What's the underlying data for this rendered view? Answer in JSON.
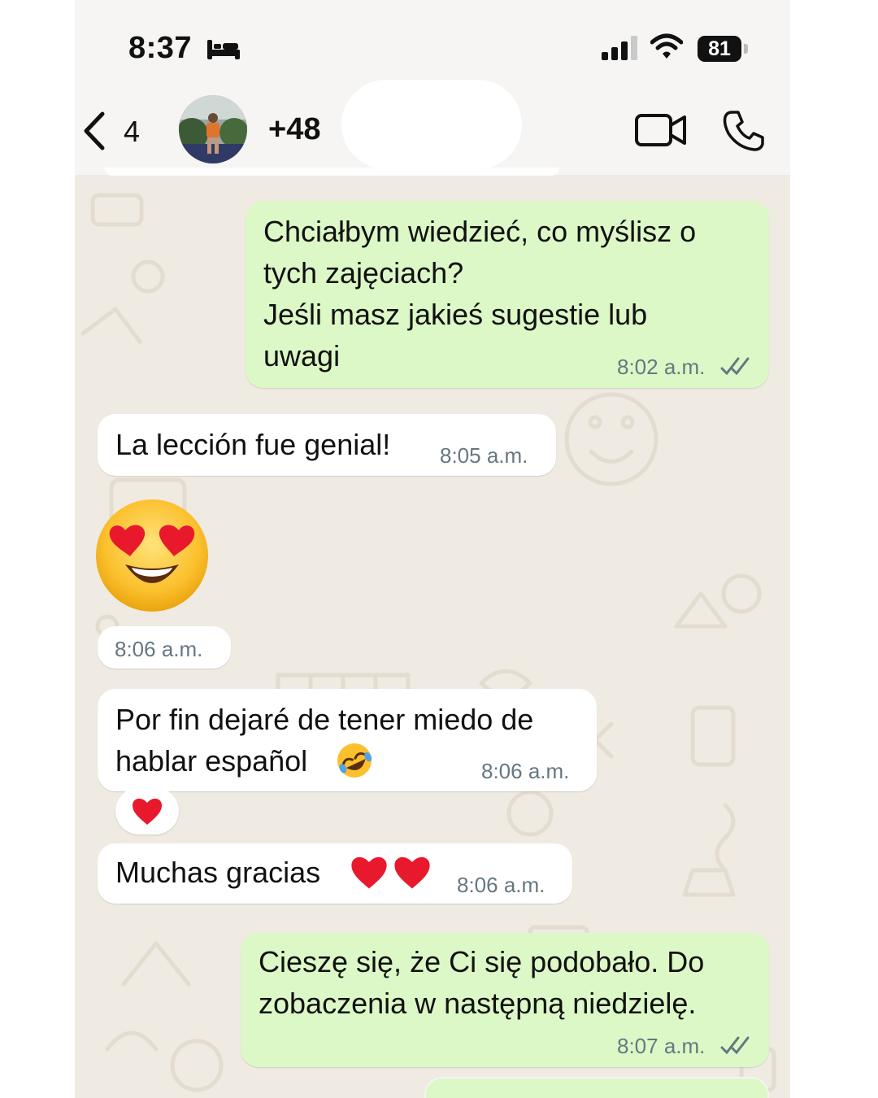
{
  "status_bar": {
    "time": "8:37",
    "battery": "81",
    "icons": [
      "bed-icon",
      "signal-icon",
      "wifi-icon",
      "battery-icon"
    ]
  },
  "header": {
    "back_count": "4",
    "contact_name": "+48",
    "icons": [
      "back-chevron-icon",
      "video-call-icon",
      "phone-call-icon"
    ]
  },
  "messages": [
    {
      "direction": "outgoing",
      "text": "Chciałbym wiedzieć, co myślisz o\ntych zajęciach?\nJeśli masz jakieś sugestie lub\nuwagi",
      "time": "8:02 a.m.",
      "status": "read"
    },
    {
      "direction": "incoming",
      "text": "La lección fue genial!",
      "time": "8:05 a.m."
    },
    {
      "direction": "incoming",
      "emoji": "smiling-face-with-heart-eyes",
      "time": "8:06 a.m."
    },
    {
      "direction": "incoming",
      "text": "Por fin dejaré de tener miedo de\nhablar español",
      "emoji": "rolling-on-the-floor-laughing",
      "time": "8:06 a.m.",
      "reaction": "red-heart"
    },
    {
      "direction": "incoming",
      "text": "Muchas gracias",
      "emoji": "red-heart x2",
      "time": "8:06 a.m."
    },
    {
      "direction": "outgoing",
      "text": "Cieszę się, że Ci się podobało. Do\nzobaczenia w następną niedzielę.",
      "time": "8:07 a.m.",
      "status": "read"
    }
  ],
  "colors": {
    "outgoing_bubble": "#dcf8c6",
    "incoming_bubble": "#ffffff",
    "chat_background": "#efeae2",
    "header_background": "#f6f5f3",
    "timestamp": "#667781",
    "read_ticks": "#667781"
  }
}
